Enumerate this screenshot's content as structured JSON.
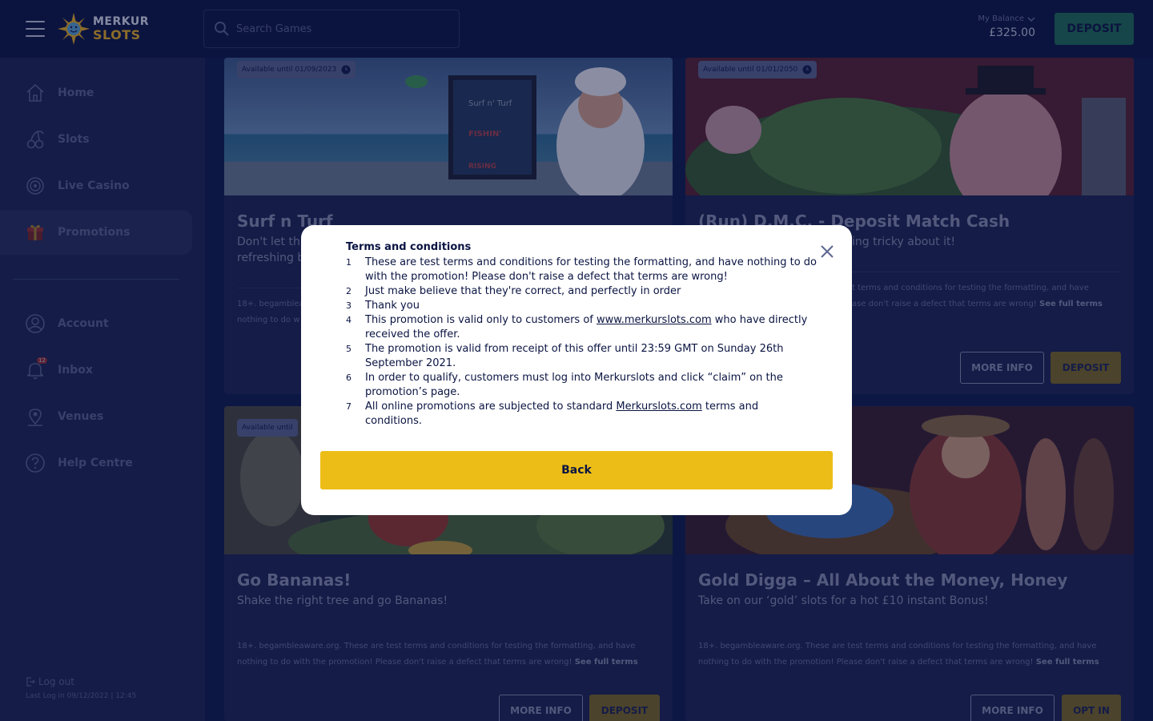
{
  "header": {
    "logo_line1": "MERKUR",
    "logo_line2": "SLOTS",
    "search_placeholder": "Search Games",
    "balance_label": "My Balance",
    "balance_amount": "£325.00",
    "deposit_label": "DEPOSIT"
  },
  "sidebar": {
    "items": [
      {
        "label": "Home",
        "icon": "home-icon"
      },
      {
        "label": "Slots",
        "icon": "cherry-icon"
      },
      {
        "label": "Live Casino",
        "icon": "roulette-icon"
      },
      {
        "label": "Promotions",
        "icon": "gift-icon",
        "active": true
      },
      {
        "label": "Account",
        "icon": "user-icon"
      },
      {
        "label": "Inbox",
        "icon": "bell-icon",
        "badge": "12"
      },
      {
        "label": "Venues",
        "icon": "location-icon"
      },
      {
        "label": "Help Centre",
        "icon": "help-icon"
      }
    ],
    "logout": "Log out",
    "last_log": "Last Log in 09/12/2022 | 12:45"
  },
  "promos": [
    {
      "badge": "Available until 01/09/2023",
      "title": "Surf n Turf",
      "subtitle": "Don't let th refreshing b",
      "terms_prefix": "18+. begamblea",
      "terms_line2": "nothing to do w"
    },
    {
      "badge": "Available until 01/01/2050",
      "title": "(Run) D.M.C. - Deposit Match Cash",
      "subtitle": "ing tricky about it!",
      "terms_line1": "t terms and conditions for testing the formatting, and have",
      "terms_line2": "ase don't raise a defect that terms are wrong!",
      "see_full": "See full terms",
      "more_info": "MORE INFO",
      "action": "DEPOSIT"
    },
    {
      "badge": "Available until",
      "title": "Go Bananas!",
      "subtitle": "Shake the right tree and go Bananas!",
      "terms_line1": "18+. begambleaware.org. These are test terms and conditions for testing the formatting, and have",
      "terms_line2": "nothing to do with the promotion! Please don't raise a defect that terms are wrong!",
      "see_full": "See full terms",
      "more_info": "MORE INFO",
      "action": "DEPOSIT"
    },
    {
      "title": "Gold Digga – All About the Money, Honey",
      "subtitle": "Take on our ‘gold’ slots for a hot £10 instant Bonus!",
      "terms_line1": "18+. begambleaware.org. These are test terms and conditions for testing the formatting, and have",
      "terms_line2": "nothing to do with the promotion! Please don't raise a defect that terms are wrong!",
      "see_full": "See full terms",
      "more_info": "MORE INFO",
      "action": "OPT IN"
    }
  ],
  "modal": {
    "title": "Terms and conditions",
    "items": [
      {
        "n": "1",
        "text": "These are test terms and conditions for testing the formatting, and have nothing to do with the promotion! Please don't raise a defect that terms are wrong!"
      },
      {
        "n": "2",
        "text": "Just make believe that they're correct, and perfectly in order"
      },
      {
        "n": "3",
        "text": "Thank you"
      },
      {
        "n": "4",
        "pre": "This promotion is valid only to customers of ",
        "link": "www.merkurslots.com",
        "post": " who have directly received the offer."
      },
      {
        "n": "5",
        "text": "The promotion is valid from receipt of this offer until 23:59 GMT on Sunday 26th September 2021."
      },
      {
        "n": "6",
        "text": "In order to qualify, customers must log into Merkurslots and click “claim” on the promotion’s page."
      },
      {
        "n": "7",
        "pre": "All online promotions are subjected to standard ",
        "link": "Merkurslots.com",
        "post": " terms and conditions."
      }
    ],
    "back_label": "Back"
  },
  "colors": {
    "header_bg": "#0a1442",
    "sidebar_bg": "#1a2350",
    "deposit_green": "#1e6f54",
    "gold": "#ecbd17",
    "logo_gold": "#f2b51c"
  }
}
